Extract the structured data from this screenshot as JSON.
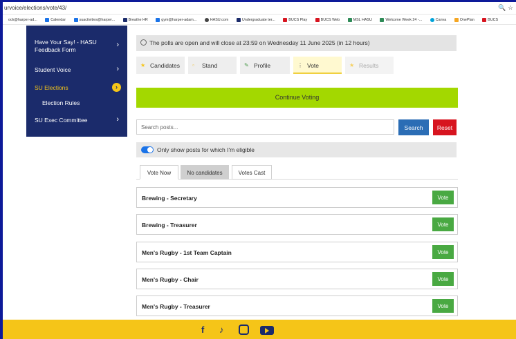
{
  "browser": {
    "url": "urvoice/elections/vote/43/",
    "bookmarks": [
      {
        "label": "ock@harper-ad...",
        "color": "#ffffff"
      },
      {
        "label": "Calendar",
        "color": "#1a73e8"
      },
      {
        "label": "suactivities@harper...",
        "color": "#1a73e8"
      },
      {
        "label": "Breathe HR",
        "color": "#1b2b6b"
      },
      {
        "label": "gym@harper-adam...",
        "color": "#1a73e8"
      },
      {
        "label": "HASU.com",
        "color": "#444444"
      },
      {
        "label": "Undergraduate ter...",
        "color": "#1b2b6b"
      },
      {
        "label": "BUCS Play",
        "color": "#d7141f"
      },
      {
        "label": "BUCS Web",
        "color": "#d7141f"
      },
      {
        "label": "MSL HASU",
        "color": "#2e8b57"
      },
      {
        "label": "Welcome Week 24 -...",
        "color": "#2e8b57"
      },
      {
        "label": "Canva",
        "color": "#00a3d9"
      },
      {
        "label": "OnePlan",
        "color": "#f5a623"
      },
      {
        "label": "BUCS",
        "color": "#d7141f"
      }
    ]
  },
  "sidebar": {
    "items": [
      {
        "label": "Have Your Say! - HASU Feedback Form"
      },
      {
        "label": "Student Voice"
      },
      {
        "label": "SU Elections"
      },
      {
        "label": "Election Rules"
      },
      {
        "label": "SU Exec Committee"
      }
    ]
  },
  "notice": {
    "text": "The polls are open and will close at 23:59 on Wednesday 11 June 2025 (in 12 hours)"
  },
  "tabs": [
    {
      "label": "Candidates",
      "icon": "star-icon"
    },
    {
      "label": "Stand",
      "icon": "document-icon"
    },
    {
      "label": "Profile",
      "icon": "edit-icon"
    },
    {
      "label": "Vote",
      "icon": "dots-icon"
    },
    {
      "label": "Results",
      "icon": "star-icon"
    }
  ],
  "continue_label": "Continue Voting",
  "search": {
    "placeholder": "Search posts...",
    "search_label": "Search",
    "reset_label": "Reset"
  },
  "eligible": {
    "label": "Only show posts for which I'm eligible",
    "checked": true
  },
  "subtabs": [
    {
      "label": "Vote Now"
    },
    {
      "label": "No candidates"
    },
    {
      "label": "Votes Cast"
    }
  ],
  "posts": [
    {
      "name": "Brewing - Secretary",
      "button": "Vote"
    },
    {
      "name": "Brewing - Treasurer",
      "button": "Vote"
    },
    {
      "name": "Men's Rugby - 1st Team Captain",
      "button": "Vote"
    },
    {
      "name": "Men's Rugby - Chair",
      "button": "Vote"
    },
    {
      "name": "Men's Rugby - Treasurer",
      "button": "Vote"
    }
  ],
  "colors": {
    "sidebar": "#1b2b6b",
    "accent_yellow": "#f5c518",
    "continue_green": "#a3d800",
    "vote_green": "#49a942",
    "search_blue": "#2b6db5",
    "reset_red": "#d7141f"
  },
  "footer": {
    "icons": [
      "facebook-icon",
      "tiktok-icon",
      "instagram-icon",
      "youtube-icon"
    ]
  }
}
